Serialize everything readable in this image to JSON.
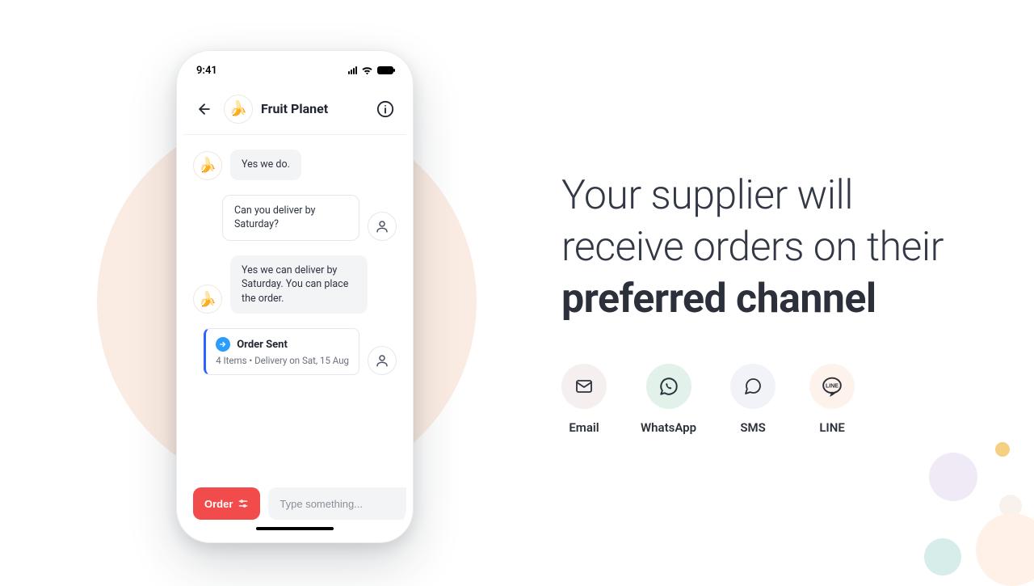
{
  "status": {
    "time": "9:41"
  },
  "chat": {
    "title": "Fruit Planet",
    "messages": {
      "m1": "Yes we do.",
      "m2": "Can you deliver by Saturday?",
      "m3": "Yes we can deliver by Saturday. You can place the order."
    },
    "order": {
      "title": "Order Sent",
      "sub": "4 Items  •  Delivery on Sat, 15 Aug"
    },
    "order_button": "Order",
    "input_placeholder": "Type something..."
  },
  "marketing": {
    "line1": "Your supplier will",
    "line2": "receive orders on their",
    "line3_bold": "preferred channel",
    "channels": {
      "email": "Email",
      "whatsapp": "WhatsApp",
      "sms": "SMS",
      "line": "LINE"
    }
  }
}
